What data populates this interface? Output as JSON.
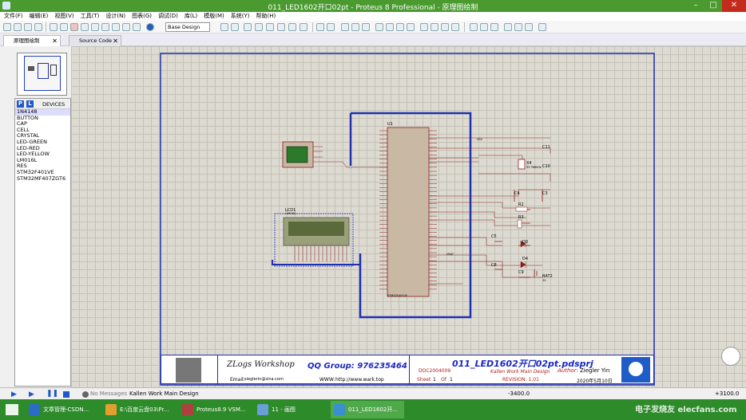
{
  "window": {
    "title": "011_LED1602开口02pt - Proteus 8 Professional - 原理图绘制",
    "minimize": "–",
    "maximize": "□",
    "close": "✕"
  },
  "menu": [
    "文件(F)",
    "编辑(E)",
    "视图(V)",
    "工具(T)",
    "设计(N)",
    "图表(G)",
    "调试(D)",
    "库(L)",
    "模版(M)",
    "系统(Y)",
    "帮助(H)"
  ],
  "toolbar": {
    "layer_select": "Base Design"
  },
  "tabs": [
    {
      "label": "原理图绘制",
      "close": "✕"
    },
    {
      "label": "Source Code",
      "close": "✕"
    }
  ],
  "devices": {
    "p_label": "P",
    "l_label": "L",
    "header": "DEVICES",
    "items": [
      "1N4148",
      "BUTTON",
      "CAP",
      "CELL",
      "CRYSTAL",
      "LED-GREEN",
      "LED-RED",
      "LED-YELLOW",
      "LM016L",
      "RES",
      "STM32F401VE",
      "STM32MF407ZGT6"
    ],
    "selected": "1N4148"
  },
  "schematic": {
    "u1": "U1",
    "chip_part": "STM32F401VE",
    "lcd": "LCD1",
    "lcd_part": "LM016L",
    "x4": "X4",
    "x4_val": "32.768kHz",
    "bat": "BAT2",
    "bat_val": "3V",
    "vbat": "VBAT",
    "vss": "VSS",
    "parts": [
      "C11",
      "C10",
      "C4",
      "C3",
      "R2",
      "R3",
      "C5",
      "D3",
      "C8",
      "D4",
      "C9"
    ]
  },
  "title_block": {
    "logo": "ZLogs Workshop",
    "email_label": "Email:",
    "email": "sieglerin@sina.com",
    "qq": "QQ Group: 976235464",
    "www_label": "WWW:",
    "www": "http://www.wark.top",
    "project": "011_LED1602开口02pt.pdsprj",
    "doc": "DOC2004009",
    "work": "Kallen Work Main Design",
    "author_label": "Author:",
    "author": "Ziegler Yin",
    "sheet_label": "Sheet",
    "sheet_num": "1",
    "of_label": "Of",
    "sheet_total": "1",
    "revision": "REVISION: 1.01",
    "date": "2020年5月10日"
  },
  "status": {
    "messages": "No Messages",
    "design": "Kallen Work Main Design",
    "coord": "-3400.0",
    "right": "+3100.0"
  },
  "taskbar": [
    {
      "label": "文章管理-CSDN...",
      "color": "#2a6cc7"
    },
    {
      "label": "E:\\百度云盘03\\Pr...",
      "color": "#e0a030"
    },
    {
      "label": "Proteus8.9 VSM...",
      "color": "#b04040"
    },
    {
      "label": "11 - 画图",
      "color": "#6a9fd8"
    },
    {
      "label": "011_LED1602开...",
      "color": "#3a8fd0"
    }
  ],
  "watermark": "电子发烧友 elecfans.com",
  "colors": {
    "titlebar": "#4a9a2f",
    "taskbar": "#2d8b2a",
    "sheet": "#dddbd1",
    "wire": "#8a1f1f",
    "border": "#1f2fb0"
  }
}
